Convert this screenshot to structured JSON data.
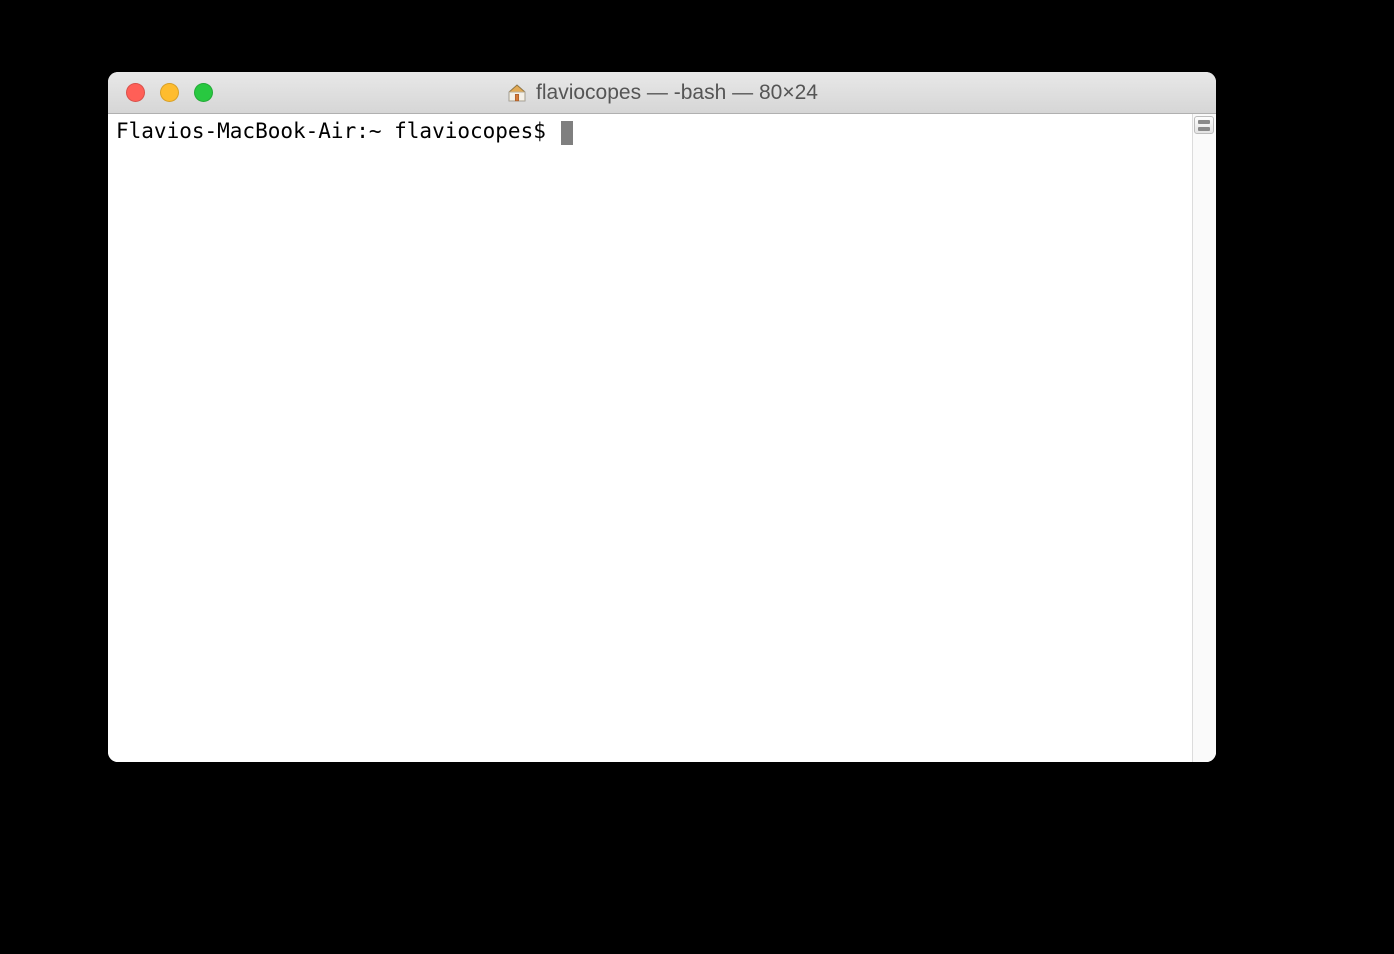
{
  "window": {
    "title": "flaviocopes — -bash — 80×24",
    "traffic_lights": {
      "close_color": "#ff5f57",
      "minimize_color": "#febc2e",
      "zoom_color": "#28c840"
    }
  },
  "terminal": {
    "prompt": "Flavios-MacBook-Air:~ flaviocopes$ ",
    "cursor_color": "#7f7f7f"
  }
}
